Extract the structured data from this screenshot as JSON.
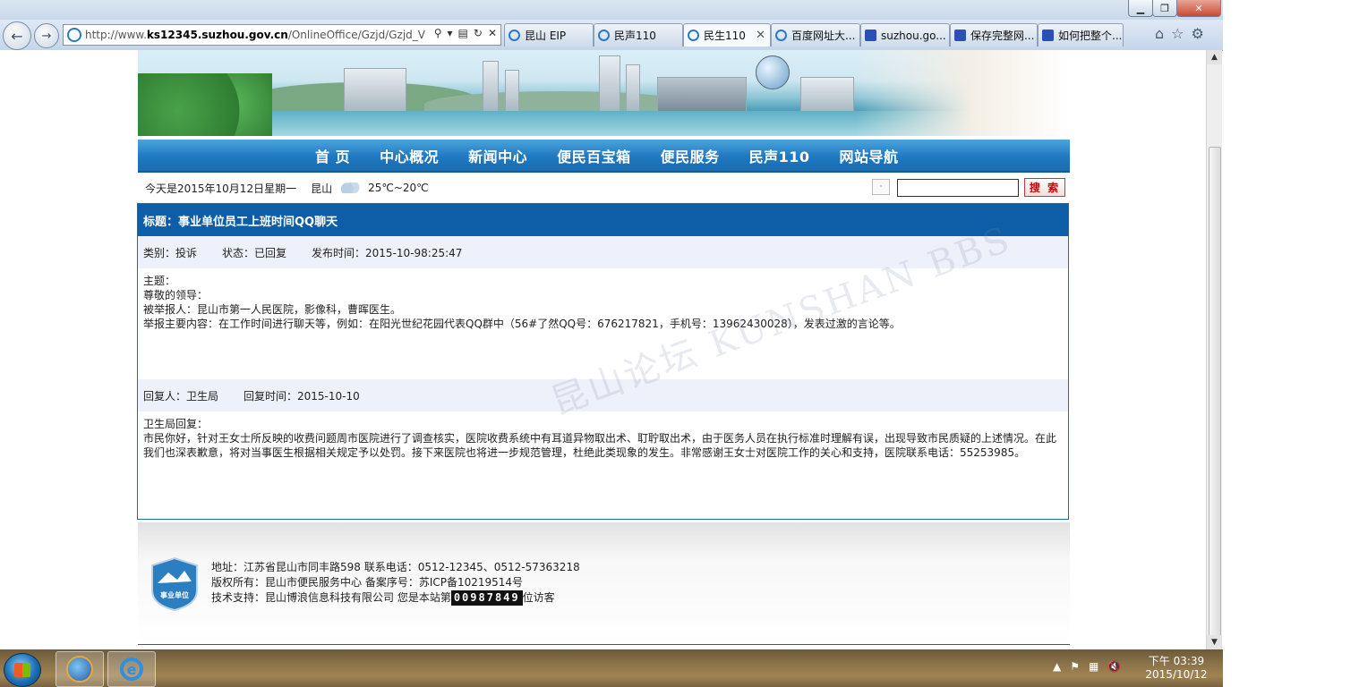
{
  "browser": {
    "window_ghost_title": "",
    "address": {
      "prefix": "http://www.",
      "domain": "ks12345.suzhou.gov.cn",
      "path": "/OnlineOffice/Gzjd/Gzjd_View.a"
    },
    "tabs": [
      {
        "label": "昆山 EIP",
        "icon": "ie-icon"
      },
      {
        "label": "民声110",
        "icon": "ie-icon"
      },
      {
        "label": "民生110",
        "icon": "ie-icon",
        "active": true
      },
      {
        "label": "百度网址大...",
        "icon": "ie-icon"
      },
      {
        "label": "suzhou.go...",
        "icon": "baidu-paw-icon"
      },
      {
        "label": "保存完整网...",
        "icon": "baidu-paw-icon"
      },
      {
        "label": "如何把整个...",
        "icon": "baidu-paw-icon"
      }
    ]
  },
  "nav": {
    "items": [
      "首 页",
      "中心概况",
      "新闻中心",
      "便民百宝箱",
      "便民服务",
      "民声110",
      "网站导航"
    ]
  },
  "info": {
    "date": "今天是2015年10月12日星期一",
    "city": "昆山",
    "temp": "25℃~20℃",
    "search_mini": "·",
    "search_button": "搜 索"
  },
  "article": {
    "title": "标题：事业单位员工上班时间QQ聊天",
    "category": "类别：投诉",
    "status": "状态：已回复",
    "published": "发布时间：2015-10-98:25:47",
    "subject_label": "主题：",
    "greeting": "尊敬的领导：",
    "reported": "被举报人：昆山市第一人民医院，影像科，曹晖医生。",
    "content": "举报主要内容：在工作时间进行聊天等，例如：在阳光世纪花园代表QQ群中（56#了然QQ号：676217821，手机号：13962430028），发表过激的言论等。",
    "reply_by": "回复人：卫生局",
    "reply_time": "回复时间：2015-10-10",
    "reply_label": "卫生局回复：",
    "reply_text": "市民你好，针对王女士所反映的收费问题周市医院进行了调查核实，医院收费系统中有耳道异物取出术、耵聍取出术，由于医务人员在执行标准时理解有误，出现导致市民质疑的上述情况。在此我们也深表歉意，将对当事医生根据相关规定予以处罚。接下来医院也将进一步规范管理，杜绝此类现象的发生。非常感谢王女士对医院工作的关心和支持，医院联系电话：55253985。",
    "watermark": "昆山论坛 KUNSHAN BBS"
  },
  "footer": {
    "address": "地址：江苏省昆山市同丰路598 联系电话：0512-12345、0512-57363218",
    "copyright": "版权所有：昆山市便民服务中心 备案序号：苏ICP备10219514号",
    "support_prefix": "技术支持：昆山博浪信息科技有限公司 您是本站第",
    "counter": "00987849",
    "support_suffix": "位访客",
    "logo_text": "事业单位"
  },
  "taskbar": {
    "time": "下午 03:39",
    "date": "2015/10/12"
  }
}
